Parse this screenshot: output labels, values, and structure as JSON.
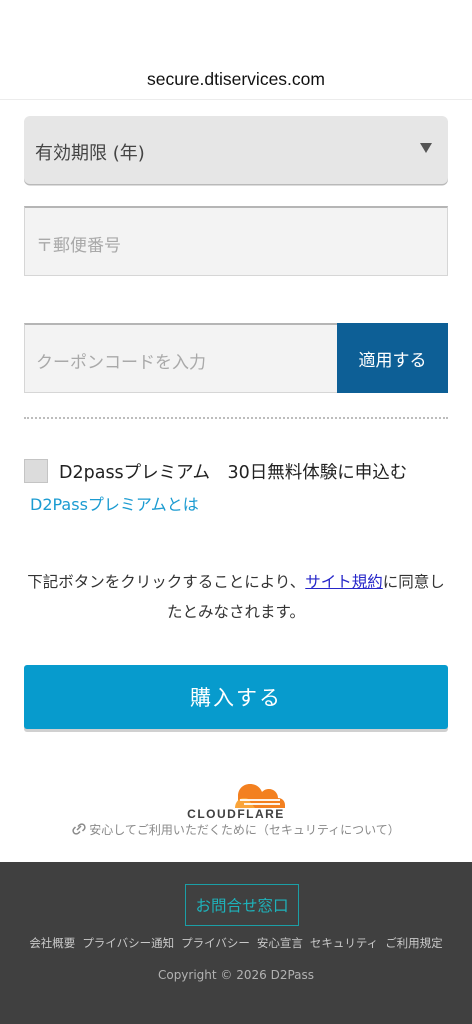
{
  "browser": {
    "url": "secure.dtiservices.com"
  },
  "form": {
    "expiry_year_select": {
      "value": "有効期限 (年)"
    },
    "zip_field": {
      "placeholder": "〒郵便番号"
    },
    "coupon_field": {
      "placeholder": "クーポンコードを入力"
    },
    "apply_button": {
      "label": "適用する"
    }
  },
  "premium": {
    "checkbox_label": "D2passプレミアム　30日無料体験に申込む",
    "checked": false,
    "info_link": "D2Passプレミアムとは"
  },
  "notice": {
    "before": "下記ボタンをクリックすることにより、",
    "link": "サイト規約",
    "after": "に同意したとみなされます。"
  },
  "buy_button": {
    "label": "購入する"
  },
  "security": {
    "brand": "CLOUDFLARE",
    "link_icon": "link-icon",
    "text": "安心してご利用いただくために（セキュリティについて）"
  },
  "footer": {
    "contact_button": "お問合せ窓口",
    "links": [
      "会社概要",
      "プライバシー通知",
      "プライバシー",
      "安心宣言",
      "セキュリティ",
      "ご利用規定"
    ],
    "copyright": "Copyright © 2026 D2Pass"
  },
  "colors": {
    "apply_bg": "#0d5f96",
    "buy_bg": "#079bcd",
    "link": "#1b9bd1",
    "footer_bg": "#404040",
    "contact_accent": "#1eb3bb",
    "cloudflare_orange": "#f38020"
  }
}
